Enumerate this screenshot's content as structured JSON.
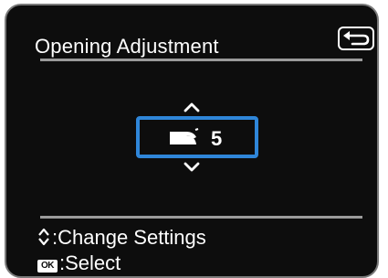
{
  "screen": {
    "title": "Opening Adjustment"
  },
  "setting": {
    "value": "5"
  },
  "help": {
    "change_label": ":Change Settings",
    "ok_badge": "OK",
    "select_label": ":Select"
  },
  "icons": {
    "back": "back-arrow-icon",
    "up": "chevron-up-icon",
    "down": "chevron-down-icon",
    "opening": "opening-icon",
    "updown": "updown-arrows-icon"
  },
  "colors": {
    "background": "#0d0d0d",
    "highlight": "#2f86d9",
    "rule": "#9a9a9a",
    "text": "#ffffff"
  }
}
